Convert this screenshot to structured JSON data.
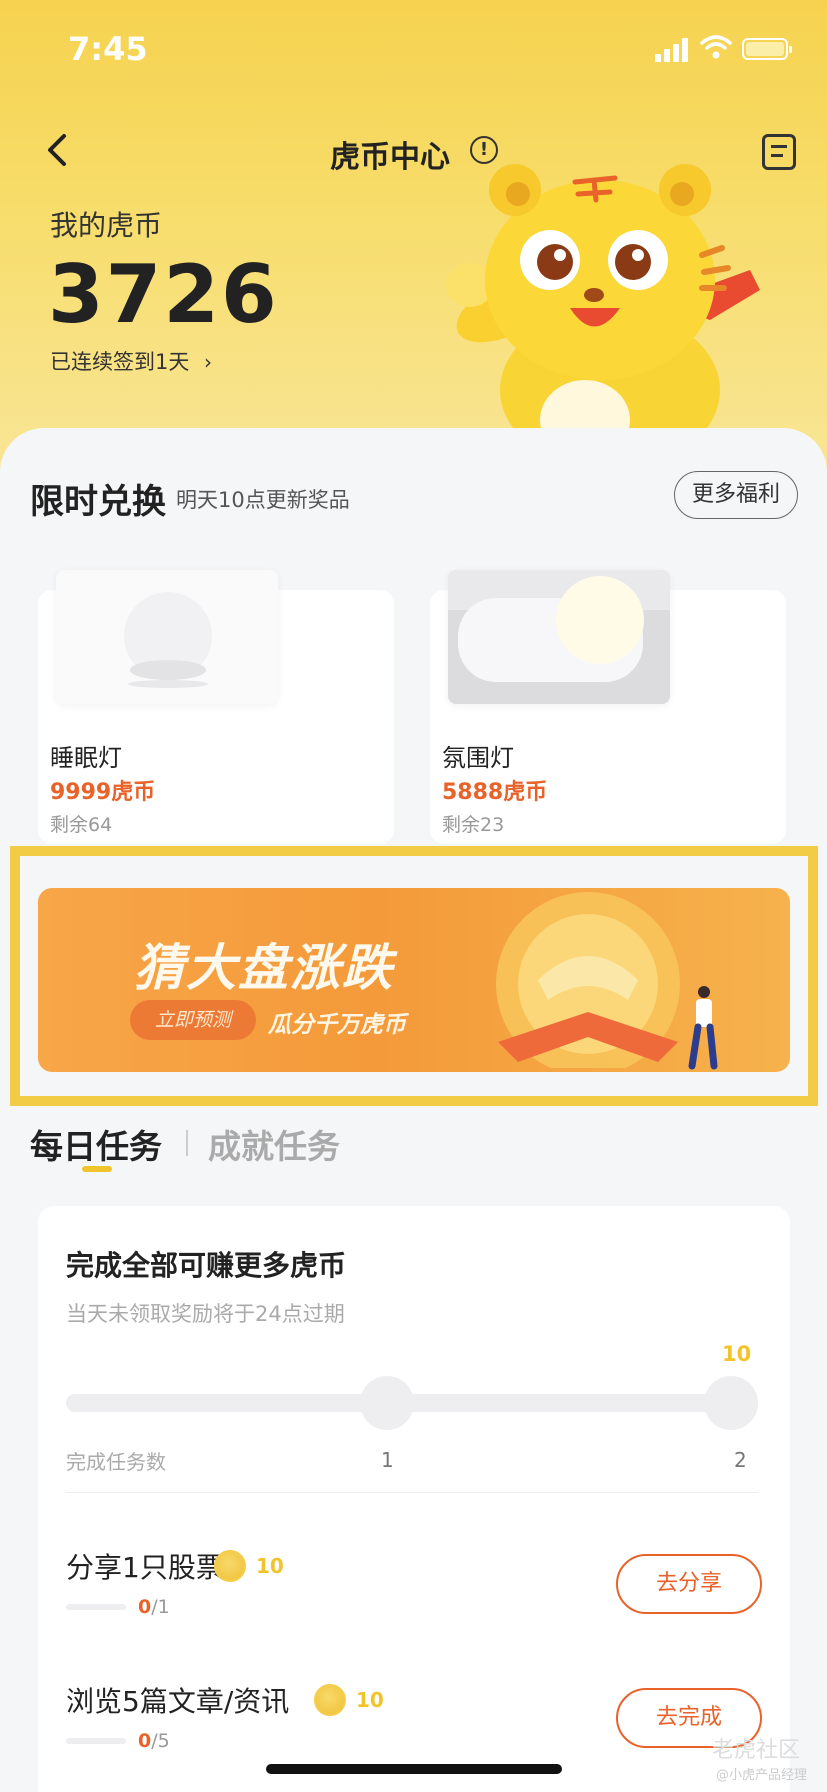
{
  "status_bar": {
    "time": "7:45"
  },
  "header": {
    "title": "虎币中心",
    "info_glyph": "!"
  },
  "wallet": {
    "label": "我的虎币",
    "balance": "3726",
    "checkin_text": "已连续签到1天",
    "checkin_chevron": "›"
  },
  "exchange": {
    "title": "限时兑换",
    "subtitle": "明天10点更新奖品",
    "more_label": "更多福利",
    "products": [
      {
        "name": "睡眠灯",
        "price": "9999虎币",
        "stock": "剩余64"
      },
      {
        "name": "氛围灯",
        "price": "5888虎币",
        "stock": "剩余23"
      }
    ]
  },
  "banner": {
    "title": "猜大盘涨跌",
    "cta": "立即预测",
    "subtitle": "瓜分千万虎币"
  },
  "tabs": {
    "daily": "每日任务",
    "achievement": "成就任务"
  },
  "task_card": {
    "title": "完成全部可赚更多虎币",
    "subtitle": "当天未领取奖励将于24点过期",
    "milestone_reward": "10",
    "completed_label": "完成任务数",
    "milestones": [
      "1",
      "2"
    ],
    "tasks": [
      {
        "name": "分享1只股票",
        "reward": "10",
        "progress_current": "0",
        "progress_total": "/1",
        "button": "去分享"
      },
      {
        "name": "浏览5篇文章/资讯",
        "reward": "10",
        "progress_current": "0",
        "progress_total": "/5",
        "button": "去完成"
      }
    ]
  },
  "watermark": {
    "main": "老虎社区",
    "sub": "@小虎产品经理"
  },
  "colors": {
    "hero_yellow": "#f6d24f",
    "accent_orange": "#e8622a",
    "coin_gold": "#f2c42c",
    "banner_orange": "#f49a3a"
  },
  "icons": [
    "signal-icon",
    "wifi-icon",
    "battery-icon",
    "back-arrow-icon",
    "info-icon",
    "document-icon",
    "chevron-right-icon",
    "coin-icon",
    "tiger-mascot-illustration"
  ]
}
